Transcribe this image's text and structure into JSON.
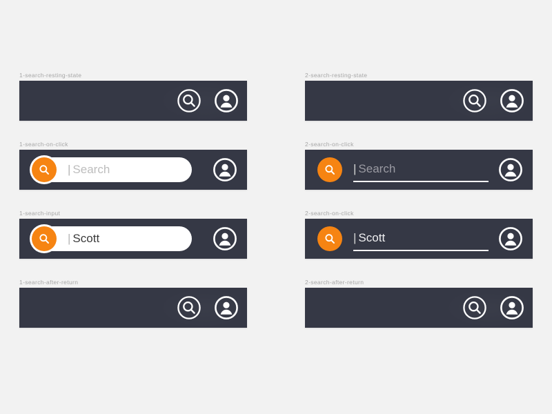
{
  "canvas": {
    "background_color": "#f2f2f2",
    "bar_color": "#353845",
    "accent_color": "#f68412",
    "label_color": "#a6a6a6",
    "pill_color": "#ffffff"
  },
  "columns": [
    {
      "id": "column-1",
      "panels": [
        {
          "label": "1-search-resting-state",
          "state": "resting",
          "variant": "pill",
          "icons": [
            "search-icon",
            "account-icon"
          ],
          "field": null
        },
        {
          "label": "1-search-on-click",
          "state": "on-click",
          "variant": "pill",
          "icons": [
            "account-icon"
          ],
          "field": {
            "button_icon": "search-icon",
            "caret": "|",
            "placeholder": "Search",
            "value": "",
            "display_text": "Search",
            "text_kind": "placeholder"
          }
        },
        {
          "label": "1-search-input",
          "state": "input",
          "variant": "pill",
          "icons": [
            "account-icon"
          ],
          "field": {
            "button_icon": "search-icon",
            "caret": "|",
            "placeholder": "Search",
            "value": "Scott",
            "display_text": "Scott",
            "text_kind": "value"
          }
        },
        {
          "label": "1-search-after-return",
          "state": "after-return",
          "variant": "pill",
          "icons": [
            "search-icon",
            "account-icon"
          ],
          "field": null
        }
      ]
    },
    {
      "id": "column-2",
      "panels": [
        {
          "label": "2-search-resting-state",
          "state": "resting",
          "variant": "underline",
          "icons": [
            "search-icon",
            "account-icon"
          ],
          "field": null
        },
        {
          "label": "2-search-on-click",
          "state": "on-click",
          "variant": "underline",
          "icons": [
            "account-icon"
          ],
          "field": {
            "button_icon": "search-icon",
            "caret": "|",
            "placeholder": "Search",
            "value": "",
            "display_text": "Search",
            "text_kind": "placeholder"
          }
        },
        {
          "label": "2-search-on-click",
          "state": "input",
          "variant": "underline",
          "icons": [
            "account-icon"
          ],
          "field": {
            "button_icon": "search-icon",
            "caret": "|",
            "placeholder": "Search",
            "value": "Scott",
            "display_text": "Scott",
            "text_kind": "value"
          }
        },
        {
          "label": "2-search-after-return",
          "state": "after-return",
          "variant": "underline",
          "icons": [
            "search-icon",
            "account-icon"
          ],
          "field": null
        }
      ]
    }
  ]
}
